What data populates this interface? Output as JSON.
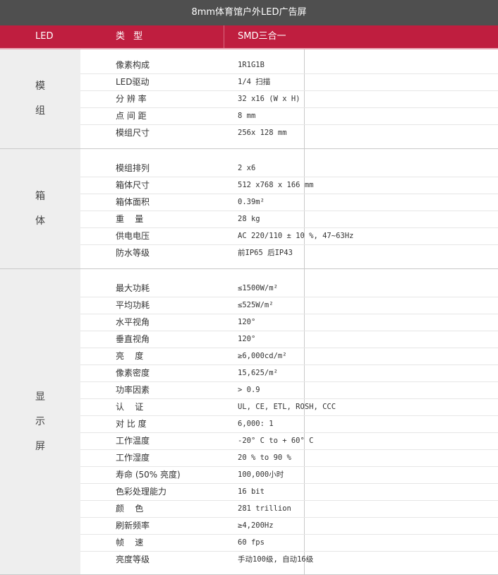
{
  "title": "8mm体育馆户外LED广告屏",
  "header": {
    "col1": "LED",
    "col2": "类 型",
    "col3": "SMD三合一"
  },
  "sections": [
    {
      "name": "模组",
      "chars": [
        "模",
        "组"
      ],
      "rows": [
        {
          "key": "像素构成",
          "value": "1R1G1B"
        },
        {
          "key": "LED驱动",
          "value": "1/4 扫描"
        },
        {
          "key": "分 辨 率",
          "value": "32 x16 (W x H)"
        },
        {
          "key": "点 间 距",
          "value": "8 mm"
        },
        {
          "key": "模组尺寸",
          "value": "256x 128 mm"
        }
      ]
    },
    {
      "name": "箱体",
      "chars": [
        "箱",
        "体"
      ],
      "rows": [
        {
          "key": "模组排列",
          "value": "2 x6"
        },
        {
          "key": "箱体尺寸",
          "value": "512 x768 x 166 mm"
        },
        {
          "key": "箱体面积",
          "value": "0.39m²"
        },
        {
          "key": "重    量",
          "value": "28 kg"
        },
        {
          "key": "供电电压",
          "value": "AC 220/110 ± 10 %, 47~63Hz"
        },
        {
          "key": "防水等级",
          "value": "前IP65 后IP43"
        }
      ]
    },
    {
      "name": "显示屏",
      "chars": [
        "显",
        "示",
        "屏"
      ],
      "rows": [
        {
          "key": "最大功耗",
          "value": "≤1500W/m²"
        },
        {
          "key": "平均功耗",
          "value": "≤525W/m²"
        },
        {
          "key": "水平视角",
          "value": "120°"
        },
        {
          "key": "垂直视角",
          "value": "120°"
        },
        {
          "key": "亮    度",
          "value": "≥6,000cd/m²"
        },
        {
          "key": "像素密度",
          "value": "15,625/m²"
        },
        {
          "key": "功率因素",
          "value": "> 0.9"
        },
        {
          "key": "认    证",
          "value": "UL, CE, ETL, ROSH, CCC"
        },
        {
          "key": "对 比 度",
          "value": "6,000: 1"
        },
        {
          "key": "工作温度",
          "value": "-20° C to + 60° C"
        },
        {
          "key": "工作湿度",
          "value": "20 % to 90 %"
        },
        {
          "key": "寿命 (50% 亮度)",
          "value": "100,000小时"
        },
        {
          "key": "色彩处理能力",
          "value": "16 bit"
        },
        {
          "key": "颜    色",
          "value": "281 trillion"
        },
        {
          "key": "刷新频率",
          "value": "≥4,200Hz"
        },
        {
          "key": "帧    速",
          "value": "60 fps"
        },
        {
          "key": "亮度等级",
          "value": "手动100级, 自动16级"
        }
      ]
    }
  ]
}
